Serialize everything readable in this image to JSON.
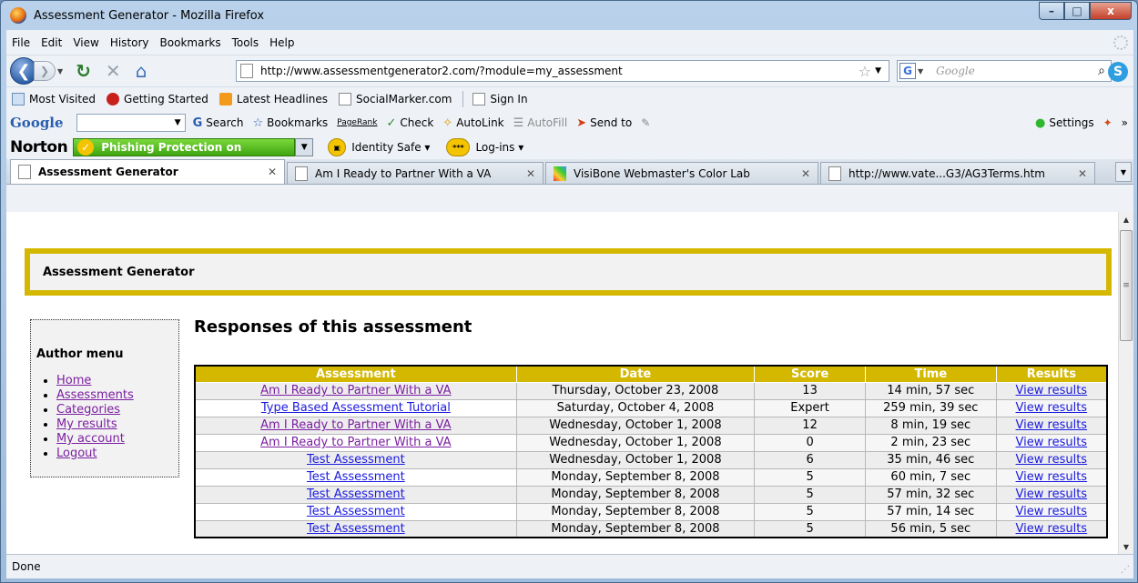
{
  "window": {
    "title": "Assessment Generator - Mozilla Firefox",
    "minimize": "–",
    "maximize": "□",
    "close": "x"
  },
  "menu": [
    "File",
    "Edit",
    "View",
    "History",
    "Bookmarks",
    "Tools",
    "Help"
  ],
  "nav": {
    "url": "http://www.assessmentgenerator2.com/?module=my_assessment",
    "search_placeholder": "Google",
    "search_engine": "G"
  },
  "bookmarks": [
    "Most Visited",
    "Getting Started",
    "Latest Headlines",
    "SocialMarker.com",
    "Sign In"
  ],
  "google_toolbar": {
    "logo": "Google",
    "search": "Search",
    "bookmarks": "Bookmarks",
    "pagerank": "PageRank",
    "check": "Check",
    "autolink": "AutoLink",
    "autofill": "AutoFill",
    "sendto": "Send to",
    "settings": "Settings"
  },
  "norton": {
    "logo": "Norton",
    "phishing": "Phishing Protection on",
    "identity": "Identity Safe",
    "logins": "Log-ins"
  },
  "tabs": [
    {
      "label": "Assessment Generator",
      "active": true
    },
    {
      "label": "Am I Ready to Partner With a VA",
      "active": false
    },
    {
      "label": "VisiBone Webmaster's Color Lab",
      "active": false
    },
    {
      "label": "http://www.vate...G3/AG3Terms.htm",
      "active": false
    }
  ],
  "page": {
    "header": "Assessment Generator",
    "menu_title": "Author menu",
    "menu_items": [
      "Home",
      "Assessments",
      "Categories",
      "My results",
      "My account",
      "Logout"
    ],
    "title": "Responses of this assessment",
    "columns": [
      "Assessment",
      "Date",
      "Score",
      "Time",
      "Results"
    ],
    "rows": [
      {
        "assessment": "Am I Ready to Partner With a VA",
        "date": "Thursday, October 23, 2008",
        "score": "13",
        "time": "14 min, 57 sec",
        "results": "View results",
        "visited": true
      },
      {
        "assessment": "Type Based Assessment Tutorial",
        "date": "Saturday, October 4, 2008",
        "score": "Expert",
        "time": "259 min, 39 sec",
        "results": "View results",
        "visited": false
      },
      {
        "assessment": "Am I Ready to Partner With a VA",
        "date": "Wednesday, October 1, 2008",
        "score": "12",
        "time": "8 min, 19 sec",
        "results": "View results",
        "visited": true
      },
      {
        "assessment": "Am I Ready to Partner With a VA",
        "date": "Wednesday, October 1, 2008",
        "score": "0",
        "time": "2 min, 23 sec",
        "results": "View results",
        "visited": true
      },
      {
        "assessment": "Test Assessment",
        "date": "Wednesday, October 1, 2008",
        "score": "6",
        "time": "35 min, 46 sec",
        "results": "View results",
        "visited": false
      },
      {
        "assessment": "Test Assessment",
        "date": "Monday, September 8, 2008",
        "score": "5",
        "time": "60 min, 7 sec",
        "results": "View results",
        "visited": false
      },
      {
        "assessment": "Test Assessment",
        "date": "Monday, September 8, 2008",
        "score": "5",
        "time": "57 min, 32 sec",
        "results": "View results",
        "visited": false
      },
      {
        "assessment": "Test Assessment",
        "date": "Monday, September 8, 2008",
        "score": "5",
        "time": "57 min, 14 sec",
        "results": "View results",
        "visited": false
      },
      {
        "assessment": "Test Assessment",
        "date": "Monday, September 8, 2008",
        "score": "5",
        "time": "56 min, 5 sec",
        "results": "View results",
        "visited": false
      }
    ]
  },
  "status": "Done",
  "colors": {
    "accent": "#d4b800",
    "link": "#1a1ae0",
    "visited": "#7b1fa2"
  }
}
